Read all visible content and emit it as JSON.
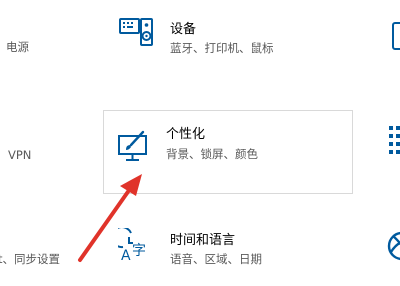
{
  "accent_color": "#005a9e",
  "arrow_color": "#e0332a",
  "left_column": {
    "network_sub": "电源",
    "vpn_sub": "VPN",
    "accounts_sub": "t、同步设置"
  },
  "devices": {
    "title": "设备",
    "subtitle": "蓝牙、打印机、鼠标",
    "icon": "keyboard-speaker-icon"
  },
  "personalization": {
    "title": "个性化",
    "subtitle": "背景、锁屏、颜色",
    "icon": "monitor-brush-icon"
  },
  "time_language": {
    "title": "时间和语言",
    "subtitle": "语音、区域、日期",
    "icon": "clock-language-icon"
  },
  "right_column": {
    "top_icon": "phone-icon",
    "mid_icon": "apps-list-icon",
    "bot_icon": "xbox-icon"
  }
}
